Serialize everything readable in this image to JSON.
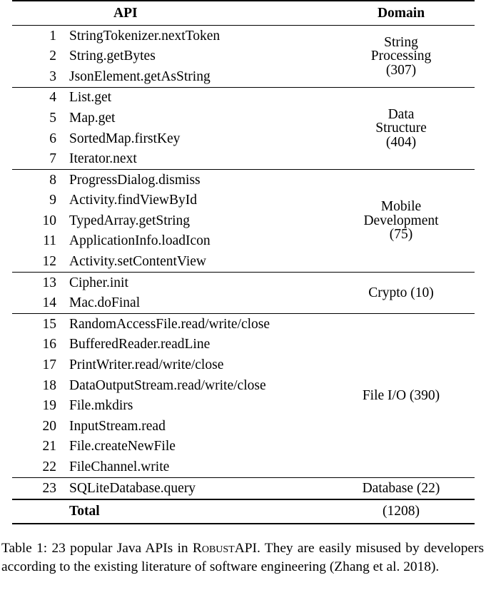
{
  "table": {
    "columns": {
      "index_header": "",
      "api_header": "API",
      "domain_header": "Domain"
    },
    "groups": [
      {
        "domain_lines": [
          "String",
          "Processing",
          "(307)"
        ],
        "domain_text": "String Processing (307)",
        "count": "307",
        "rows": [
          {
            "index": "1",
            "api": "StringTokenizer.nextToken"
          },
          {
            "index": "2",
            "api": "String.getBytes"
          },
          {
            "index": "3",
            "api": "JsonElement.getAsString"
          }
        ]
      },
      {
        "domain_lines": [
          "Data",
          "Structure",
          "(404)"
        ],
        "domain_text": "Data Structure (404)",
        "count": "404",
        "rows": [
          {
            "index": "4",
            "api": "List.get"
          },
          {
            "index": "5",
            "api": "Map.get"
          },
          {
            "index": "6",
            "api": "SortedMap.firstKey"
          },
          {
            "index": "7",
            "api": "Iterator.next"
          }
        ]
      },
      {
        "domain_lines": [
          "Mobile",
          "Development",
          "(75)"
        ],
        "domain_text": "Mobile Development (75)",
        "count": "75",
        "rows": [
          {
            "index": "8",
            "api": "ProgressDialog.dismiss"
          },
          {
            "index": "9",
            "api": "Activity.findViewById"
          },
          {
            "index": "10",
            "api": "TypedArray.getString"
          },
          {
            "index": "11",
            "api": "ApplicationInfo.loadIcon"
          },
          {
            "index": "12",
            "api": "Activity.setContentView"
          }
        ]
      },
      {
        "domain_lines": [
          "Crypto (10)"
        ],
        "domain_text": "Crypto (10)",
        "count": "10",
        "rows": [
          {
            "index": "13",
            "api": "Cipher.init"
          },
          {
            "index": "14",
            "api": "Mac.doFinal"
          }
        ]
      },
      {
        "domain_lines": [
          "File I/O (390)"
        ],
        "domain_text": "File I/O (390)",
        "count": "390",
        "rows": [
          {
            "index": "15",
            "api": "RandomAccessFile.read/write/close"
          },
          {
            "index": "16",
            "api": "BufferedReader.readLine"
          },
          {
            "index": "17",
            "api": "PrintWriter.read/write/close"
          },
          {
            "index": "18",
            "api": "DataOutputStream.read/write/close"
          },
          {
            "index": "19",
            "api": "File.mkdirs"
          },
          {
            "index": "20",
            "api": "InputStream.read"
          },
          {
            "index": "21",
            "api": "File.createNewFile"
          },
          {
            "index": "22",
            "api": "FileChannel.write"
          }
        ]
      },
      {
        "domain_lines": [
          "Database (22)"
        ],
        "domain_text": "Database (22)",
        "count": "22",
        "rows": [
          {
            "index": "23",
            "api": "SQLiteDatabase.query"
          }
        ]
      }
    ],
    "total": {
      "label": "Total",
      "value": "(1208)"
    }
  },
  "caption": {
    "prefix": "Table 1: 23 popular Java APIs in ",
    "system_name_first": "R",
    "system_name_small": "OBUST",
    "system_name_suffix": "API",
    "suffix": ". They are easily misused by developers according to the existing literature of software engineering (Zhang et al. 2018).",
    "full_text": "Table 1: 23 popular Java APIs in ROBUSTAPI. They are easily misused by developers according to the existing literature of software engineering (Zhang et al. 2018)."
  },
  "colors": {
    "text": "#000000",
    "background": "#ffffff",
    "rule": "#000000"
  }
}
